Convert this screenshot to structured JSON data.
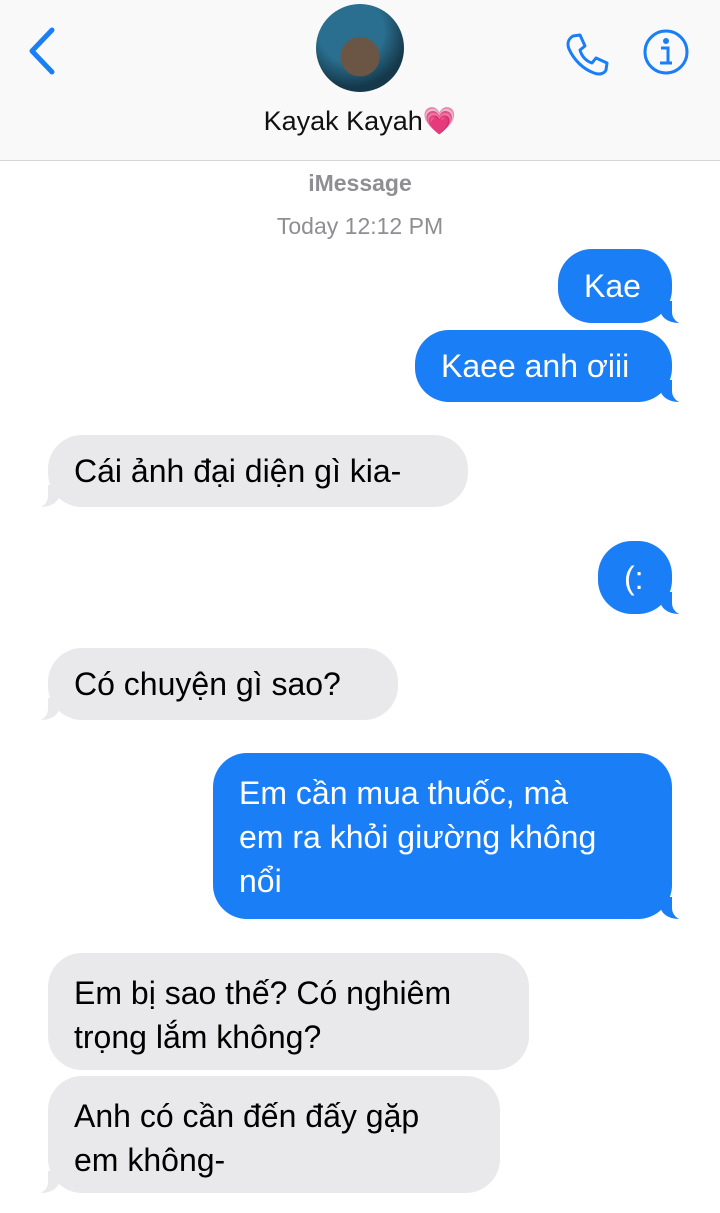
{
  "header": {
    "contact_name": "Kayak Kayah",
    "contact_emoji": "💗",
    "back_icon": "chevron-left-icon",
    "call_icon": "phone-icon",
    "info_icon": "info-icon",
    "accent_color": "#1a7ef7"
  },
  "thread": {
    "service": "iMessage",
    "timestamp": "Today 12:12 PM"
  },
  "messages": [
    {
      "direction": "outgoing",
      "text": "Kae"
    },
    {
      "direction": "outgoing",
      "text": "Kaee anh ơiii"
    },
    {
      "direction": "incoming",
      "text": "Cái ảnh đại diện gì kia-"
    },
    {
      "direction": "outgoing",
      "text": "(:"
    },
    {
      "direction": "incoming",
      "text": "Có chuyện gì sao?"
    },
    {
      "direction": "outgoing",
      "lines": [
        "Em cần mua thuốc, mà",
        "em ra khỏi giường không",
        "nổi"
      ]
    },
    {
      "direction": "incoming",
      "lines": [
        "Em bị sao thế? Có nghiêm",
        "trọng lắm không?"
      ]
    },
    {
      "direction": "incoming",
      "lines": [
        "Anh có cần đến đấy gặp",
        "em không-"
      ]
    }
  ]
}
